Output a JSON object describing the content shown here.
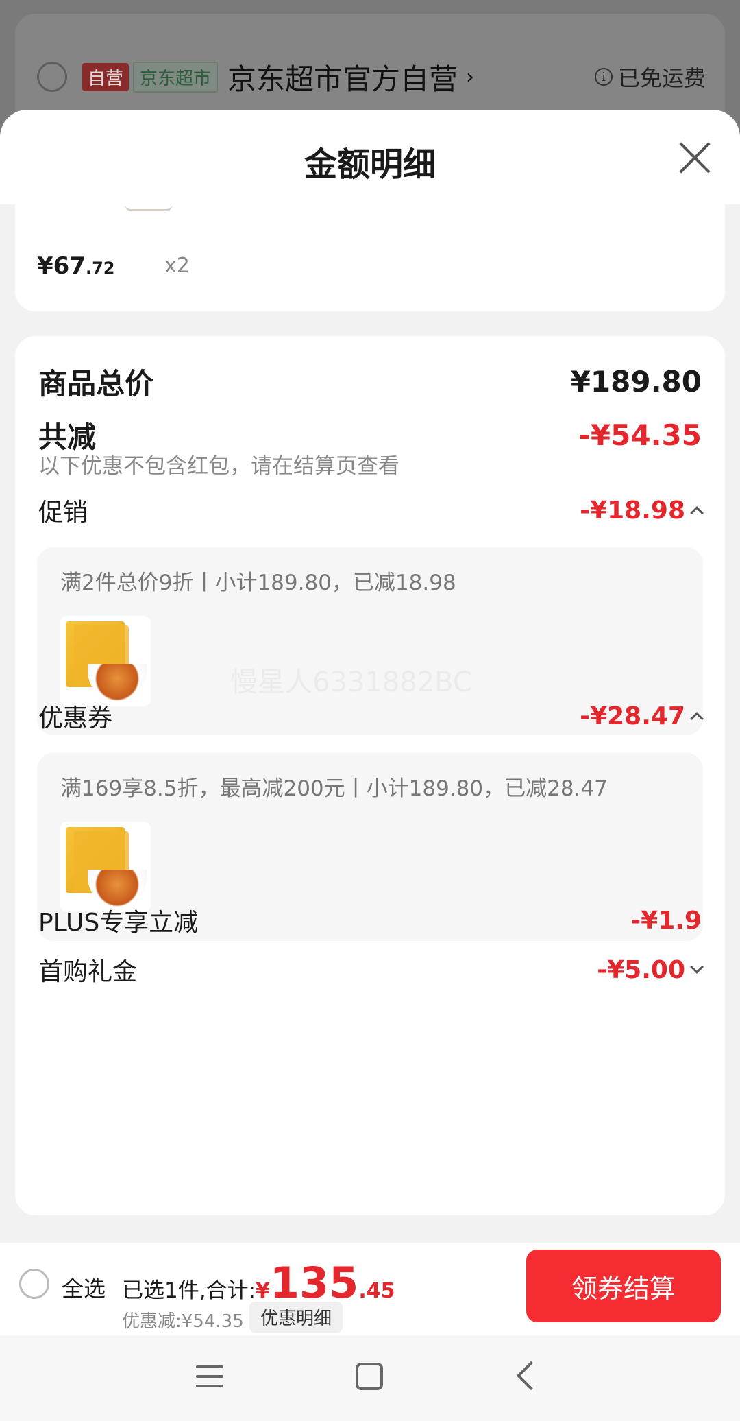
{
  "background_store": {
    "tag_self": "自营",
    "tag_market": "京东超市",
    "store_name": "京东超市官方自营",
    "shipping": "已免运费"
  },
  "sheet": {
    "title": "金额明细"
  },
  "item": {
    "price_main": "¥67",
    "price_decimal": ".72",
    "quantity": "x2"
  },
  "details": {
    "total_label": "商品总价",
    "total_value": "¥189.80",
    "reduce_label": "共减",
    "reduce_value": "-¥54.35",
    "note": "以下优惠不包含红包，请在结算页查看",
    "promotion_label": "促销",
    "promotion_value": "-¥18.98",
    "promotion_text": "满2件总价9折丨小计189.80，已减18.98",
    "coupon_label": "优惠券",
    "coupon_value": "-¥28.47",
    "coupon_text": "满169享8.5折，最高减200元丨小计189.80，已减28.47",
    "plus_label": "PLUS专享立减",
    "plus_value": "-¥1.9",
    "first_label": "首购礼金",
    "first_value": "-¥5.00",
    "watermark": "慢星人6331882BC"
  },
  "bottom": {
    "select_all": "全选",
    "selected_prefix": "已选1件,合计:",
    "currency": "¥",
    "total_int": "135",
    "total_dec": ".45",
    "discount": "优惠减:¥54.35",
    "detail_button": "优惠明细",
    "checkout": "领券结算"
  }
}
